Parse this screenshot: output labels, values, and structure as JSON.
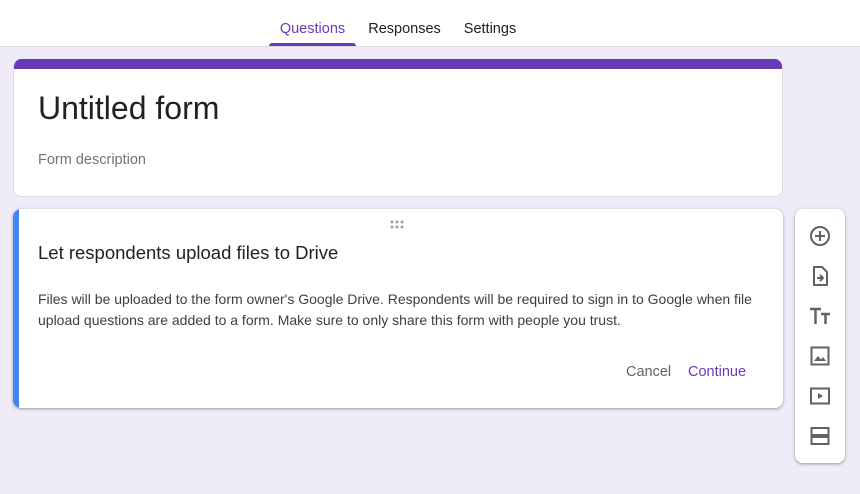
{
  "tabs": [
    {
      "label": "Questions",
      "active": true
    },
    {
      "label": "Responses",
      "active": false
    },
    {
      "label": "Settings",
      "active": false
    }
  ],
  "form": {
    "title": "Untitled form",
    "description_placeholder": "Form description"
  },
  "dialog": {
    "title": "Let respondents upload files to Drive",
    "body": "Files will be uploaded to the form owner's Google Drive. Respondents will be required to sign in to Google when file upload questions are added to a form. Make sure to only share this form with people you trust.",
    "cancel_label": "Cancel",
    "continue_label": "Continue"
  },
  "toolbar": {
    "items": [
      {
        "icon": "add-circle-icon"
      },
      {
        "icon": "import-questions-icon"
      },
      {
        "icon": "title-text-icon"
      },
      {
        "icon": "image-icon"
      },
      {
        "icon": "video-icon"
      },
      {
        "icon": "section-icon"
      }
    ]
  },
  "colors": {
    "accent": "#673ab7",
    "background": "#f0ebf8",
    "focus_bar": "#4285f4"
  }
}
